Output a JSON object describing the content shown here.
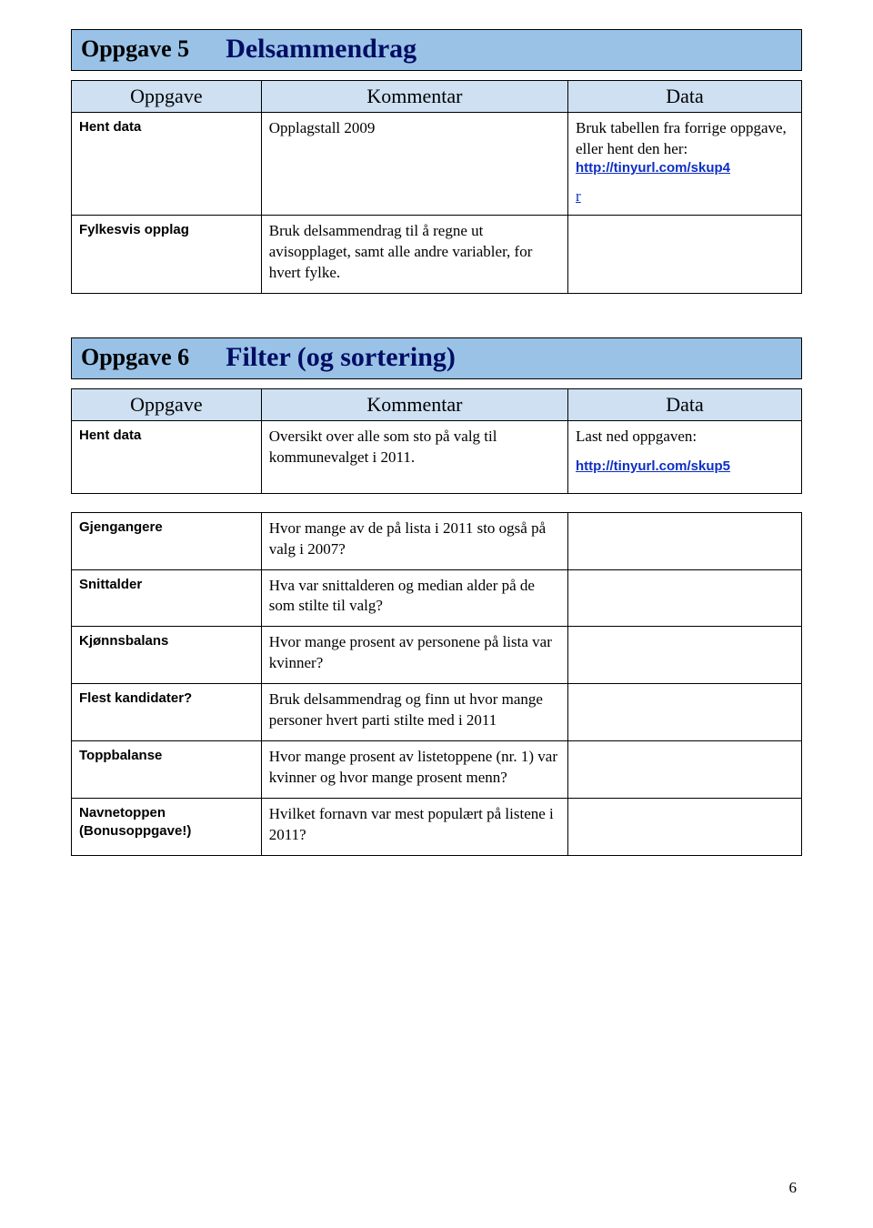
{
  "section5": {
    "num": "Oppgave 5",
    "title": "Delsammendrag",
    "header": {
      "c1": "Oppgave",
      "c2": "Kommentar",
      "c3": "Data"
    },
    "rows": {
      "hentdata": {
        "label": "Hent data",
        "kom": "Opplagstall 2009",
        "data_pre": "Bruk tabellen fra forrige oppgave, eller hent den her:",
        "link": "http://tinyurl.com/skup4",
        "r": "r"
      },
      "fylkesvis": {
        "label": "Fylkesvis opplag",
        "kom": "Bruk delsammendrag til å regne ut avisopplaget, samt alle andre variabler, for hvert fylke."
      }
    }
  },
  "section6": {
    "num": "Oppgave 6",
    "title": "Filter (og sortering)",
    "header": {
      "c1": "Oppgave",
      "c2": "Kommentar",
      "c3": "Data"
    },
    "rows": {
      "hentdata": {
        "label": "Hent data",
        "kom": "Oversikt over alle som sto på valg til kommunevalget i 2011.",
        "data_pre": "Last ned oppgaven:",
        "link": "http://tinyurl.com/skup5"
      },
      "gjengangere": {
        "label": "Gjengangere",
        "kom": "Hvor mange av de på lista i 2011 sto også på valg i 2007?"
      },
      "snittalder": {
        "label": "Snittalder",
        "kom": "Hva var snittalderen og median alder på de som stilte til valg?"
      },
      "kjonnsbalans": {
        "label": "Kjønnsbalans",
        "kom": "Hvor mange prosent av personene på lista var kvinner?"
      },
      "flest": {
        "label": "Flest kandidater?",
        "kom": "Bruk delsammendrag og finn ut hvor mange personer hvert parti stilte med i 2011"
      },
      "toppbalanse": {
        "label": "Toppbalanse",
        "kom": "Hvor mange prosent av listetoppene (nr. 1) var kvinner og hvor mange prosent menn?"
      },
      "navnetoppen": {
        "label": "Navnetoppen (Bonusoppgave!)",
        "kom": "Hvilket fornavn var mest populært på listene i 2011?"
      }
    }
  },
  "page_number": "6"
}
